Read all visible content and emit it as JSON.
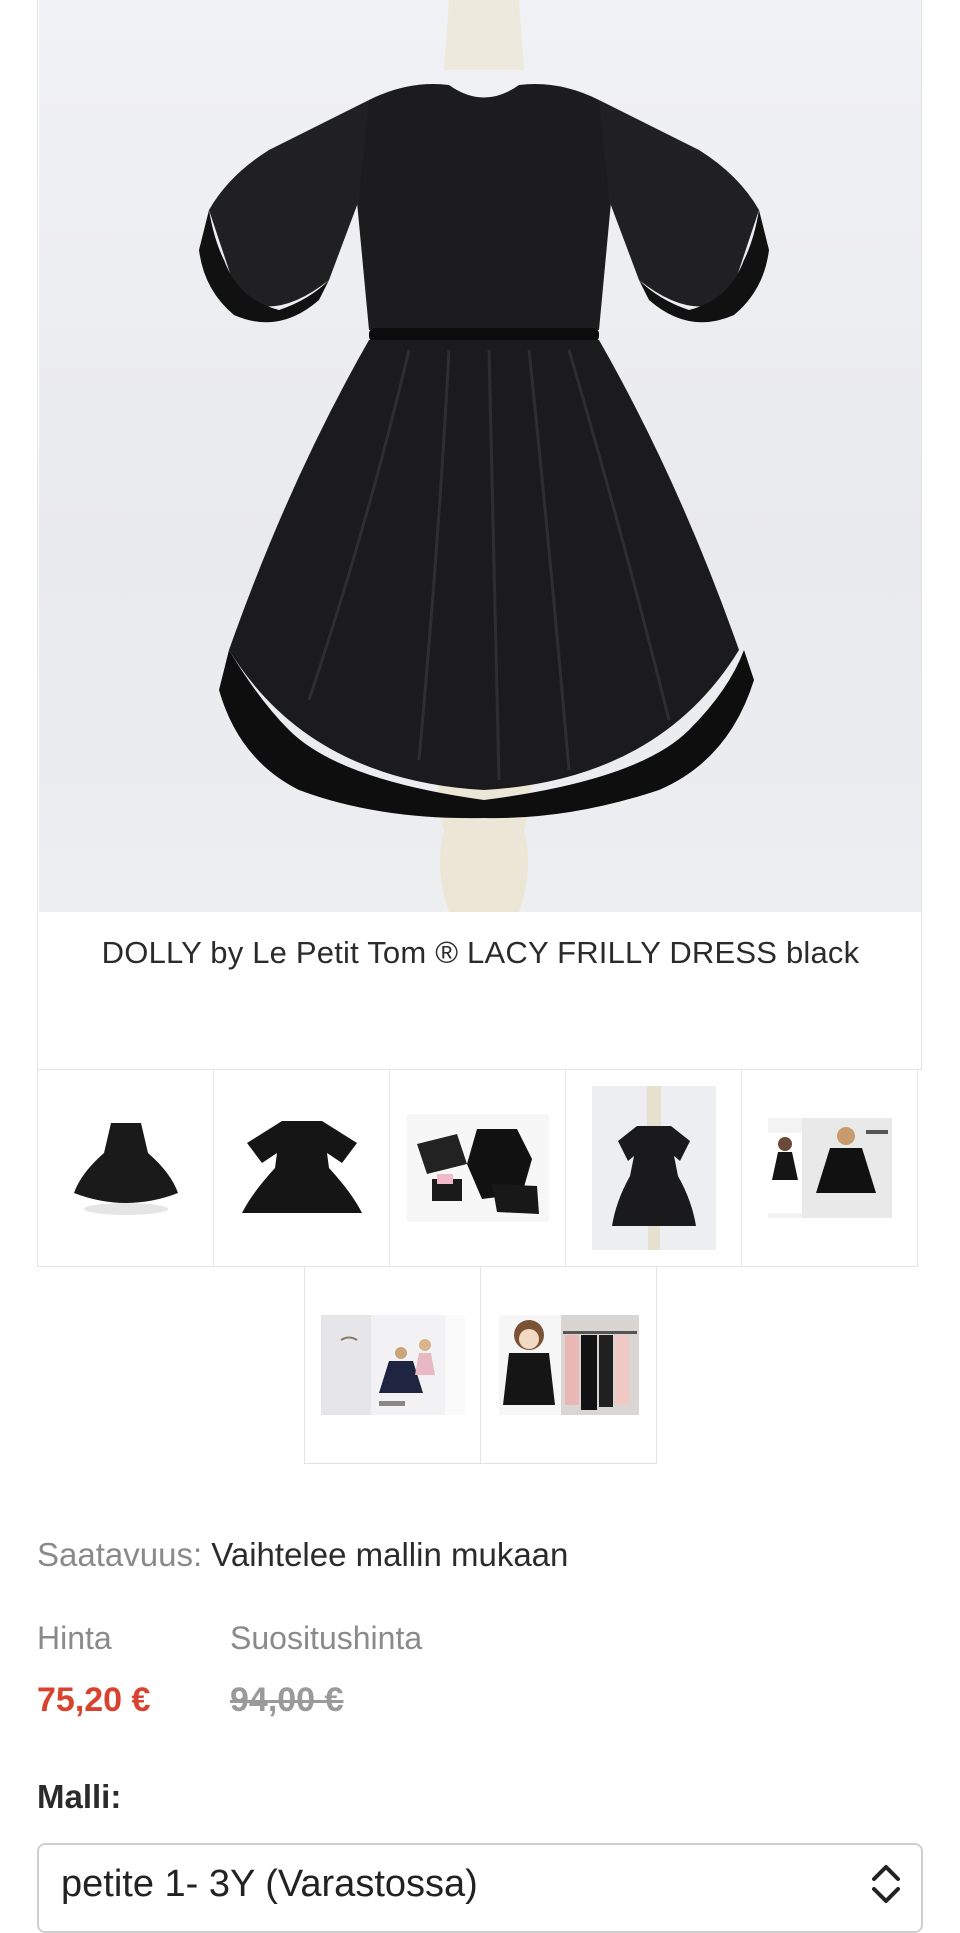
{
  "product": {
    "title": "DOLLY by Le Petit Tom ® LACY FRILLY DRESS black",
    "main_image": "black lace frilly dress on mannequin"
  },
  "thumbnails": [
    {
      "name": "thumbnail-1",
      "depicts": "dress twirl side view"
    },
    {
      "name": "thumbnail-2",
      "depicts": "dress front flat"
    },
    {
      "name": "thumbnail-3",
      "depicts": "dress with accessories"
    },
    {
      "name": "thumbnail-4",
      "depicts": "dress on mannequin"
    },
    {
      "name": "thumbnail-5",
      "depicts": "child wearing dress with brand"
    },
    {
      "name": "thumbnail-6",
      "depicts": "children in dresses"
    },
    {
      "name": "thumbnail-7",
      "depicts": "doll and clothing rack"
    }
  ],
  "availability": {
    "label": "Saatavuus:",
    "value": "Vaihtelee mallin mukaan"
  },
  "price": {
    "label": "Hinta",
    "value": "75,20 €",
    "recommended_label": "Suositushinta",
    "recommended_value": "94,00 €"
  },
  "model": {
    "label": "Malli:",
    "selected": "petite 1- 3Y (Varastossa)"
  },
  "colors": {
    "sale_price": "#d9422e",
    "muted_text": "#8a8a8a"
  }
}
